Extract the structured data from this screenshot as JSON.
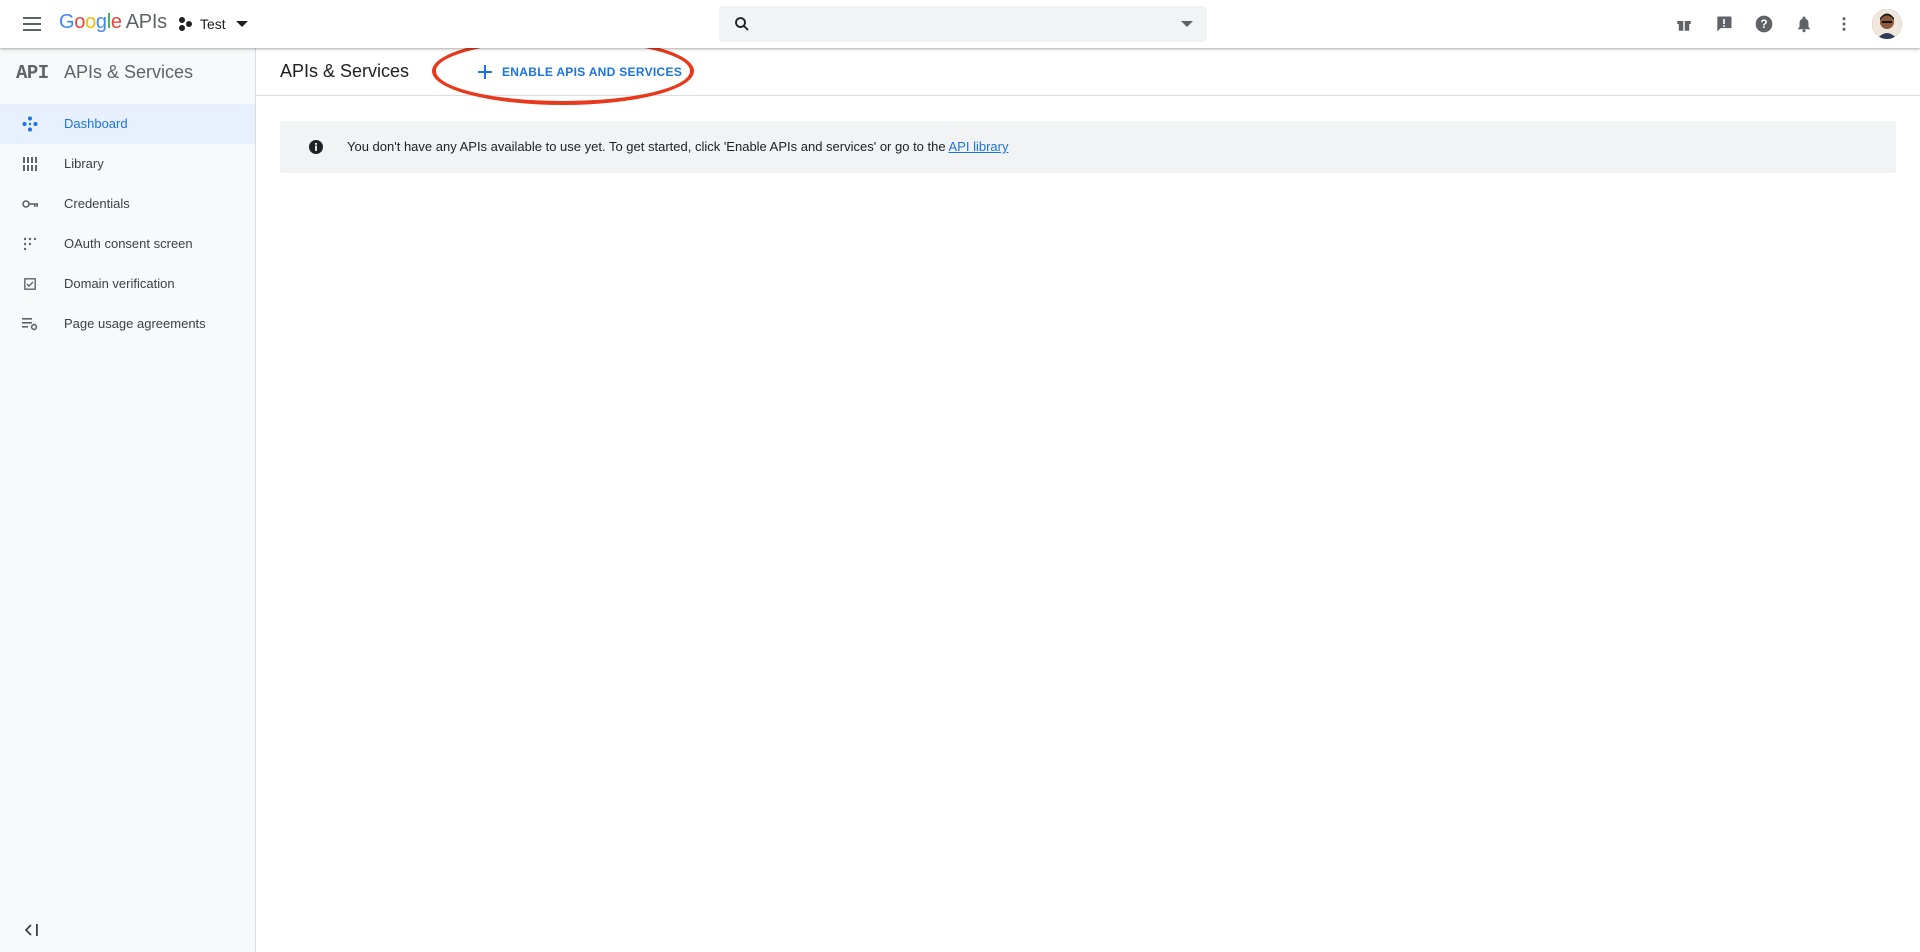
{
  "topbar": {
    "logo_google": [
      "G",
      "o",
      "o",
      "g",
      "l",
      "e"
    ],
    "logo_suffix": "APIs",
    "project_name": "Test",
    "search_value": "",
    "search_placeholder": ""
  },
  "sidebar": {
    "mark": "API",
    "title": "APIs & Services",
    "items": [
      {
        "label": "Dashboard",
        "icon": "dashboard-icon",
        "active": true
      },
      {
        "label": "Library",
        "icon": "library-icon",
        "active": false
      },
      {
        "label": "Credentials",
        "icon": "key-icon",
        "active": false
      },
      {
        "label": "OAuth consent screen",
        "icon": "oauth-icon",
        "active": false
      },
      {
        "label": "Domain verification",
        "icon": "domain-check-icon",
        "active": false
      },
      {
        "label": "Page usage agreements",
        "icon": "list-settings-icon",
        "active": false
      }
    ]
  },
  "main": {
    "title": "APIs & Services",
    "enable_button_label": "ENABLE APIS AND SERVICES",
    "info": {
      "text": "You don't have any APIs available to use yet. To get started, click 'Enable APIs and services' or go to the ",
      "link_text": "API library"
    }
  },
  "colors": {
    "accent": "#1a73e8",
    "highlight": "#e8391c",
    "sidebar_bg": "#f8f9fa",
    "active_bg": "#e8f0fe"
  }
}
